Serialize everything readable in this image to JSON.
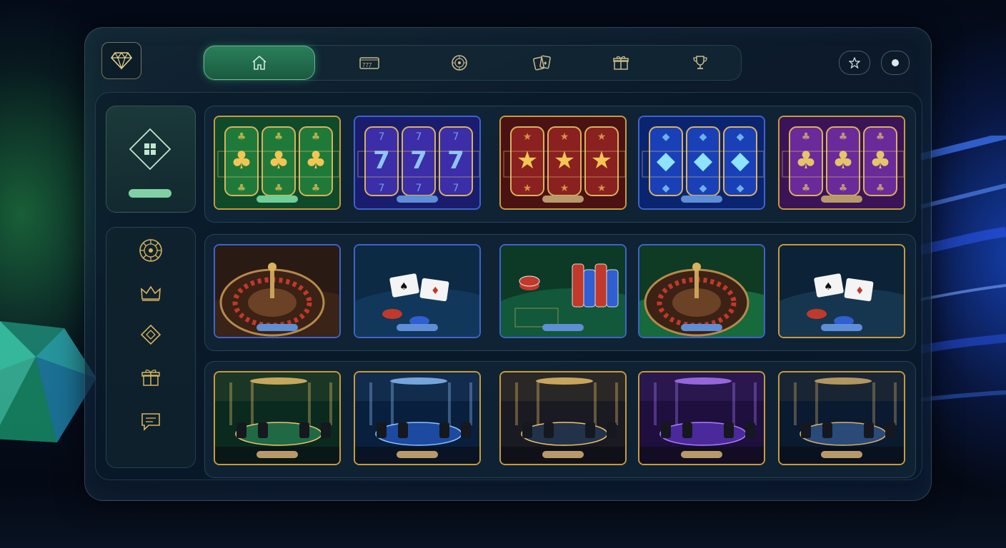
{
  "colors": {
    "accent_green": "#2a7f5a",
    "gold": "#d6b25e",
    "blue_glow": "#2d5bff",
    "panel_bg": "#0e1e30"
  },
  "header": {
    "logo_icon": "diamond-icon",
    "nav": [
      {
        "icon": "home-icon",
        "active": true
      },
      {
        "icon": "slot-machine-icon",
        "active": false
      },
      {
        "icon": "roulette-icon",
        "active": false
      },
      {
        "icon": "playing-cards-icon",
        "active": false
      },
      {
        "icon": "gift-icon",
        "active": false
      },
      {
        "icon": "trophy-icon",
        "active": false
      }
    ],
    "right_buttons": [
      "favorites-star-icon",
      "toggle-dot-icon"
    ]
  },
  "sidebar": {
    "top_item": {
      "icon": "grid-diamond-icon",
      "active": true
    },
    "items": [
      {
        "icon": "roulette-chip-icon"
      },
      {
        "icon": "crown-icon"
      },
      {
        "icon": "diamond-outline-icon"
      },
      {
        "icon": "gift-icon"
      },
      {
        "icon": "chat-icon"
      }
    ]
  },
  "rows": [
    {
      "category": "slots",
      "cards": [
        {
          "theme": "green clover bell slot",
          "bg": "#0f4a2a",
          "reel": "#1f7a3a",
          "symbol": "♣",
          "symbol_color": "#f3c653",
          "border": "#c79b3b",
          "cta": "#6fcf97"
        },
        {
          "theme": "blue seven slot",
          "bg": "#1a1c6e",
          "reel": "#3b2ea8",
          "symbol": "7",
          "symbol_color": "#8ec5ff",
          "border": "#3f63c9",
          "cta": "#5d8ed6"
        },
        {
          "theme": "red star slot",
          "bg": "#4a1212",
          "reel": "#8a2020",
          "symbol": "★",
          "symbol_color": "#f3c653",
          "border": "#c79b3b",
          "cta": "#b89a6a"
        },
        {
          "theme": "blue diamond slot",
          "bg": "#0b2470",
          "reel": "#1a40b8",
          "symbol": "◆",
          "symbol_color": "#8ee3ff",
          "border": "#3f63c9",
          "cta": "#5d8ed6"
        },
        {
          "theme": "purple clover slot",
          "bg": "#3a1456",
          "reel": "#6a2a9a",
          "symbol": "♣",
          "symbol_color": "#e7c46a",
          "border": "#c79b3b",
          "cta": "#b89a6a"
        }
      ]
    },
    {
      "category": "table games",
      "cards": [
        {
          "theme": "roulette wheel",
          "bg": "#2a1a14",
          "felt": "#3a2418",
          "kind": "roulette",
          "border": "#3f63c9",
          "cta": "#5d8ed6"
        },
        {
          "theme": "blackjack blue felt",
          "bg": "#0c2a44",
          "felt": "#11385a",
          "kind": "cards",
          "border": "#3f63c9",
          "cta": "#5d8ed6"
        },
        {
          "theme": "poker chips green felt",
          "bg": "#0c3a26",
          "felt": "#12583a",
          "kind": "chips",
          "border": "#3f63c9",
          "cta": "#5d8ed6"
        },
        {
          "theme": "roulette green table",
          "bg": "#0f3a24",
          "felt": "#166a3c",
          "kind": "roulette",
          "border": "#3f63c9",
          "cta": "#5d8ed6"
        },
        {
          "theme": "baccarat table",
          "bg": "#0c2236",
          "felt": "#163650",
          "kind": "cards",
          "border": "#c79b3b",
          "cta": "#5d8ed6"
        }
      ]
    },
    {
      "category": "live casino rooms",
      "cards": [
        {
          "theme": "green lounge table",
          "bg": "#0a2a20",
          "table": "#1f6a44",
          "light": "#f1c66a",
          "border": "#c79b3b",
          "cta": "#b89a6a"
        },
        {
          "theme": "blue lounge table",
          "bg": "#08203e",
          "table": "#1c4aa0",
          "light": "#8ec5ff",
          "border": "#c79b3b",
          "cta": "#b89a6a"
        },
        {
          "theme": "gold lounge",
          "bg": "#1a1a22",
          "table": "#22324a",
          "light": "#f1c66a",
          "border": "#c79b3b",
          "cta": "#b89a6a"
        },
        {
          "theme": "purple lounge",
          "bg": "#1e0f3e",
          "table": "#4a2a9a",
          "light": "#b07cff",
          "border": "#c79b3b",
          "cta": "#b89a6a"
        },
        {
          "theme": "navy lounge",
          "bg": "#0a1a30",
          "table": "#2a4a7a",
          "light": "#d8b36a",
          "border": "#c79b3b",
          "cta": "#b89a6a"
        }
      ]
    }
  ]
}
